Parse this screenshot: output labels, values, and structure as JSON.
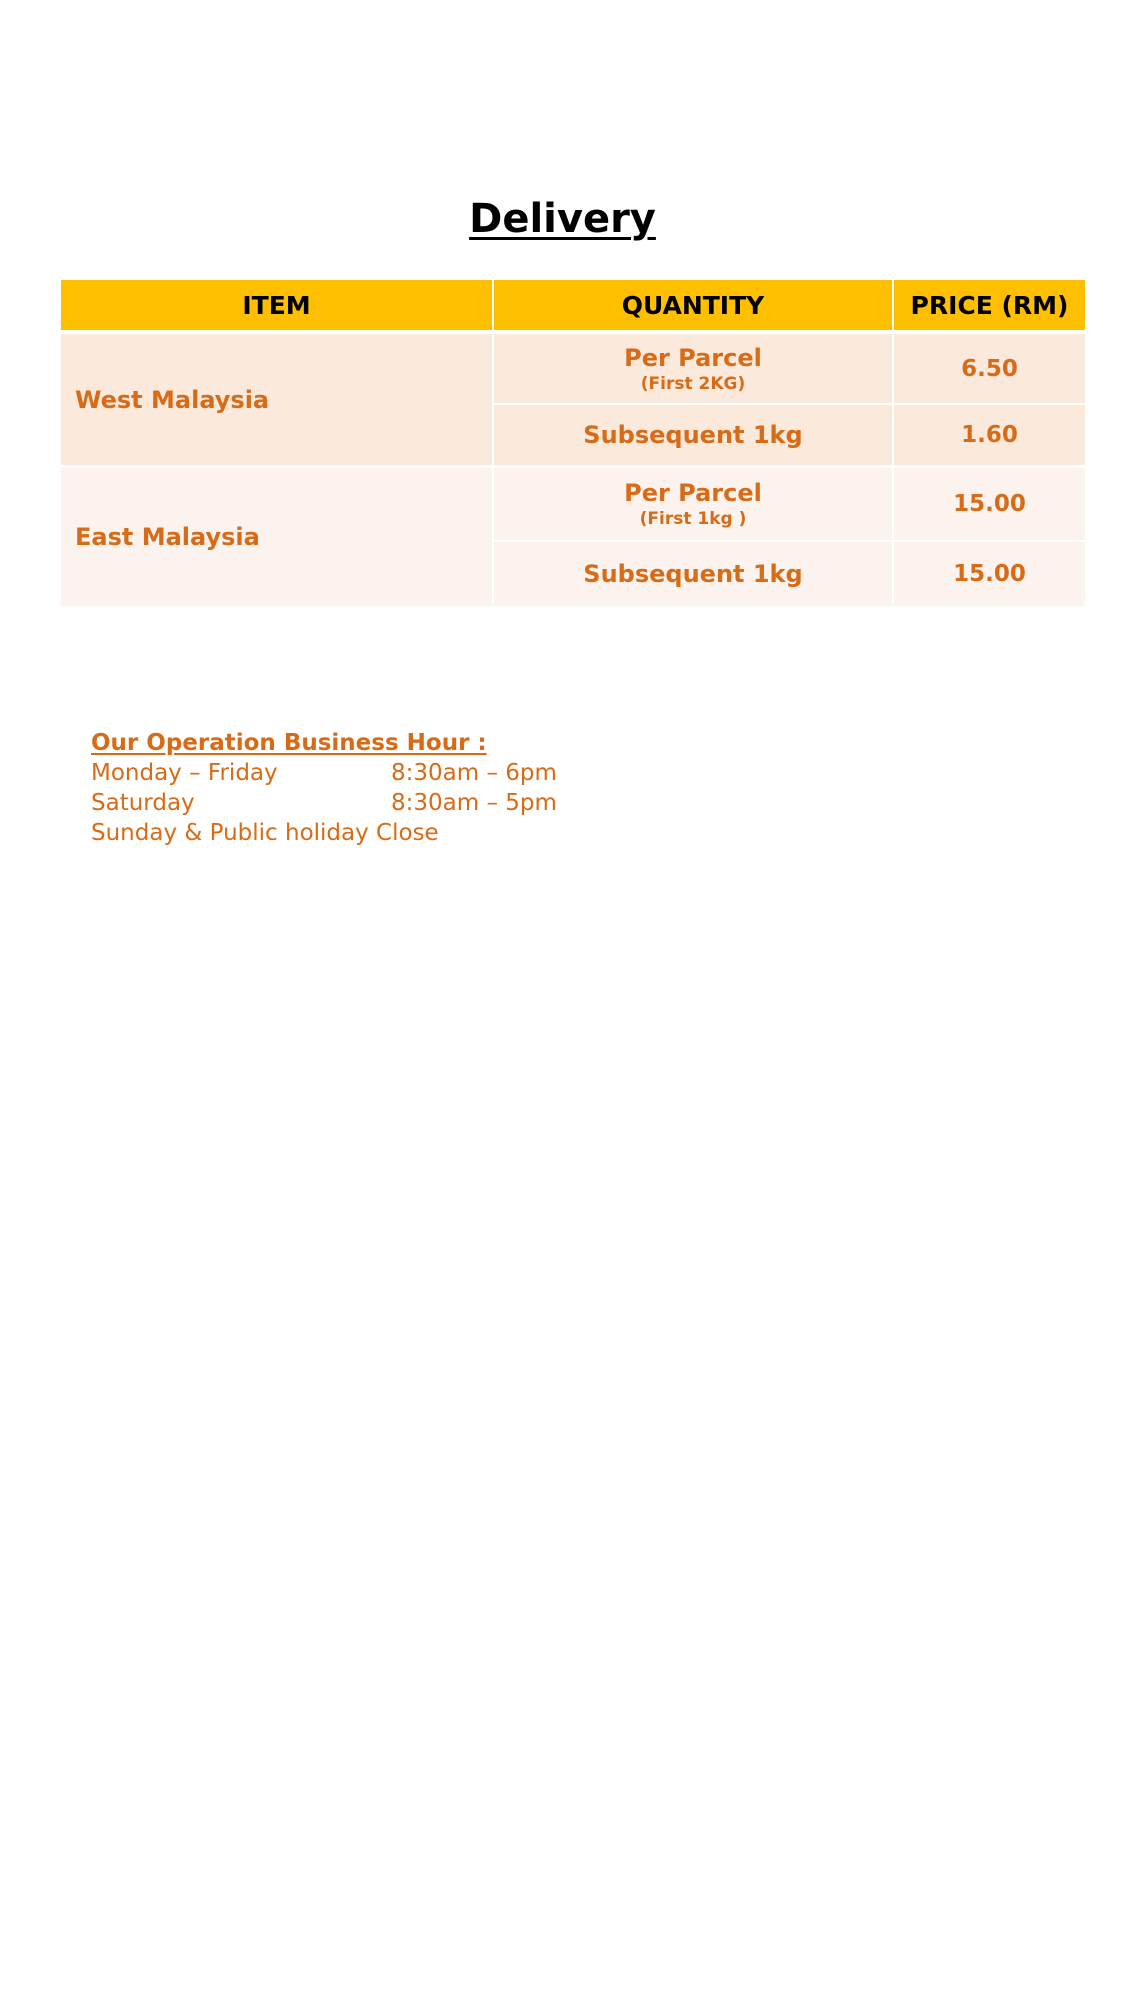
{
  "title": "Delivery",
  "table": {
    "headers": {
      "item": "ITEM",
      "quantity": "QUANTITY",
      "price": "PRICE (RM)"
    },
    "regions": [
      {
        "item": "West Malaysia",
        "rows": [
          {
            "quantity": "Per Parcel",
            "quantity_note": "(First 2KG)",
            "price": "6.50"
          },
          {
            "quantity": "Subsequent 1kg",
            "quantity_note": "",
            "price": "1.60"
          }
        ]
      },
      {
        "item": "East Malaysia",
        "rows": [
          {
            "quantity": "Per Parcel",
            "quantity_note": "(First 1kg )",
            "price": "15.00"
          },
          {
            "quantity": "Subsequent 1kg",
            "quantity_note": "",
            "price": "15.00"
          }
        ]
      }
    ]
  },
  "business_hours": {
    "title": "Our Operation Business Hour :",
    "rows": [
      {
        "day": "Monday – Friday",
        "time": "8:30am – 6pm"
      },
      {
        "day": "Saturday",
        "time": "8:30am – 5pm"
      },
      {
        "day": "Sunday & Public holiday",
        "time": "Close"
      }
    ]
  },
  "colors": {
    "header_bg": "#fdbf00",
    "text_orange": "#d86b17",
    "band_west": "#fbe9dc",
    "band_east": "#fcf3ee"
  }
}
